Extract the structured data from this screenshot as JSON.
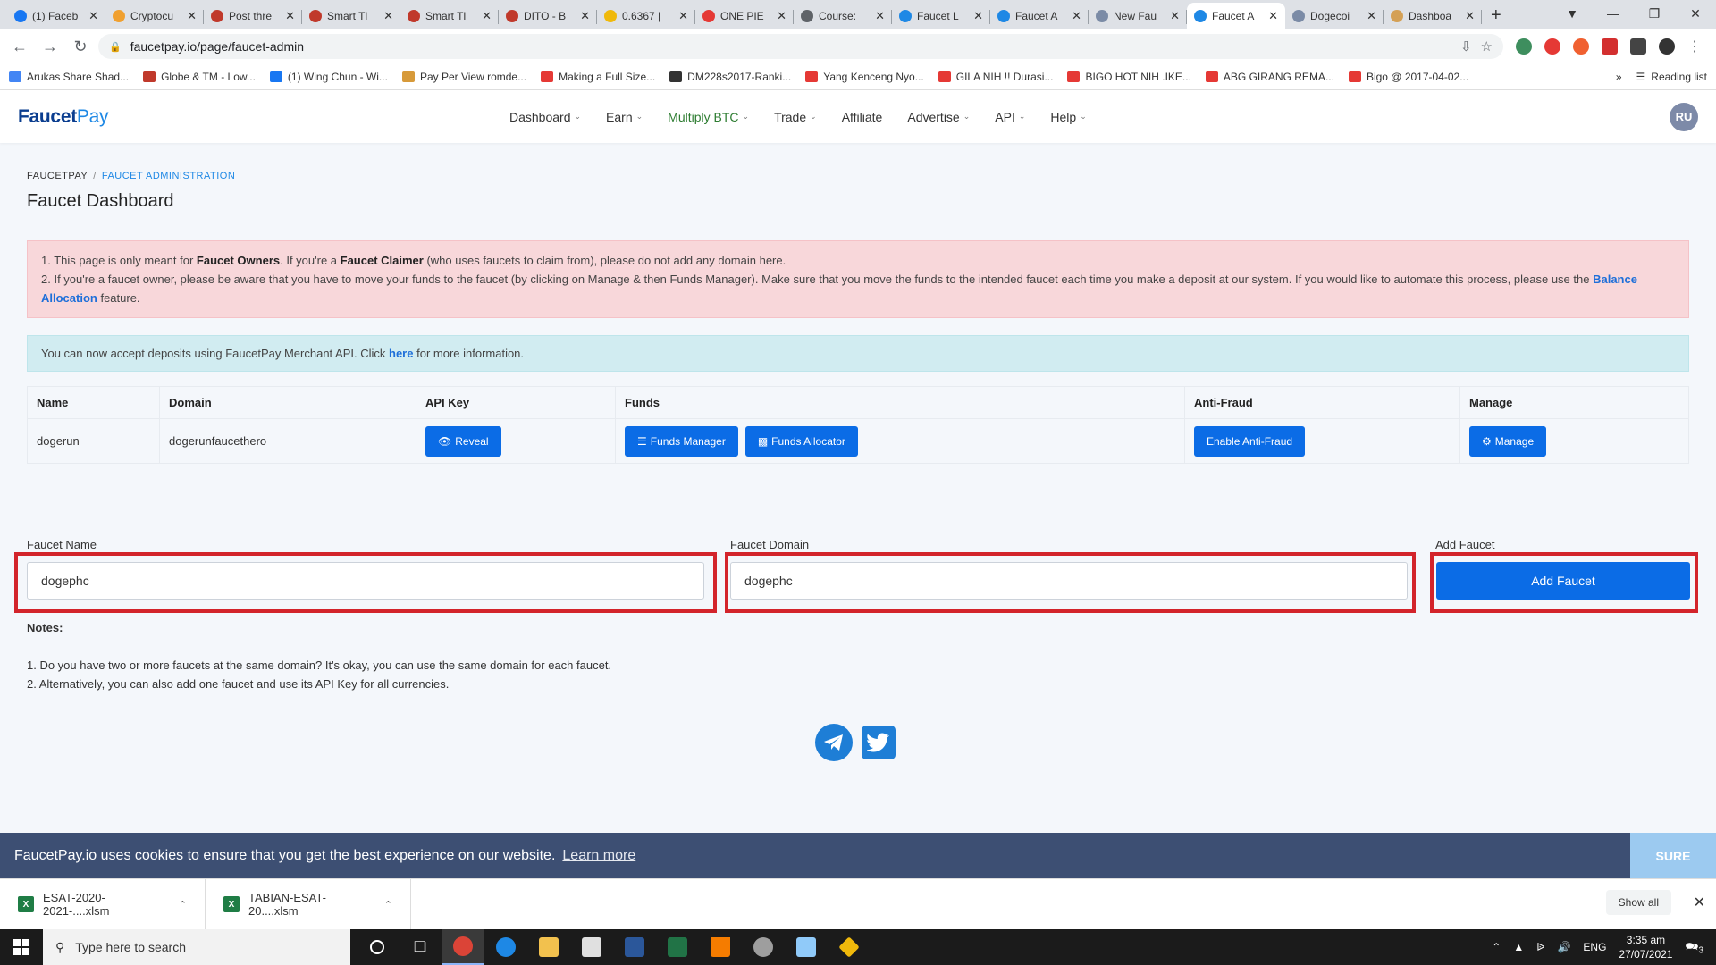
{
  "browser": {
    "tabs": [
      {
        "title": "(1) Faceb",
        "color": "#1877f2"
      },
      {
        "title": "Cryptocu",
        "color": "#f0a030"
      },
      {
        "title": "Post thre",
        "color": "#c0392b"
      },
      {
        "title": "Smart Tl",
        "color": "#c0392b"
      },
      {
        "title": "Smart Tl",
        "color": "#c0392b"
      },
      {
        "title": "DITO - B",
        "color": "#c0392b"
      },
      {
        "title": "0.6367 |",
        "color": "#f0b90b"
      },
      {
        "title": "ONE PIE",
        "color": "#e53935"
      },
      {
        "title": "Course:",
        "color": "#5f6368"
      },
      {
        "title": "Faucet L",
        "color": "#1e88e5"
      },
      {
        "title": "Faucet A",
        "color": "#1e88e5"
      },
      {
        "title": "New Fau",
        "color": "#7b8ba6"
      },
      {
        "title": "Faucet A",
        "color": "#1e88e5"
      },
      {
        "title": "Dogecoi",
        "color": "#7b8ba6"
      },
      {
        "title": "Dashboa",
        "color": "#d4a055"
      }
    ],
    "active_tab_index": 12,
    "url": "faucetpay.io/page/faucet-admin",
    "bookmarks": [
      {
        "label": "Arukas Share Shad...",
        "color": "#4285f4"
      },
      {
        "label": "Globe & TM - Low...",
        "color": "#c0392b"
      },
      {
        "label": "(1) Wing Chun - Wi...",
        "color": "#1877f2"
      },
      {
        "label": "Pay Per View romde...",
        "color": "#d79a3a"
      },
      {
        "label": "Making a Full Size...",
        "color": "#e53935"
      },
      {
        "label": "DM228s2017-Ranki...",
        "color": "#333333"
      },
      {
        "label": "Yang Kenceng Nyo...",
        "color": "#e53935"
      },
      {
        "label": "GILA NIH !! Durasi...",
        "color": "#e53935"
      },
      {
        "label": "BIGO HOT NIH .IKE...",
        "color": "#e53935"
      },
      {
        "label": "ABG GIRANG REMA...",
        "color": "#e53935"
      },
      {
        "label": "Bigo @ 2017-04-02...",
        "color": "#e53935"
      }
    ],
    "reading_list": "Reading list"
  },
  "site": {
    "logo_faucet": "Faucet",
    "logo_pay": "Pay",
    "nav": [
      {
        "label": "Dashboard",
        "caret": true,
        "highlight": false
      },
      {
        "label": "Earn",
        "caret": true,
        "highlight": false
      },
      {
        "label": "Multiply BTC",
        "caret": true,
        "highlight": true
      },
      {
        "label": "Trade",
        "caret": true,
        "highlight": false
      },
      {
        "label": "Affiliate",
        "caret": false,
        "highlight": false
      },
      {
        "label": "Advertise",
        "caret": true,
        "highlight": false
      },
      {
        "label": "API",
        "caret": true,
        "highlight": false
      },
      {
        "label": "Help",
        "caret": true,
        "highlight": false
      }
    ],
    "avatar": "RU"
  },
  "page": {
    "breadcrumb_home": "FAUCETPAY",
    "breadcrumb_sep": "/",
    "breadcrumb_current": "FAUCET ADMINISTRATION",
    "title": "Faucet Dashboard",
    "alert1": {
      "l1_a": "1. This page is only meant for ",
      "l1_b": "Faucet Owners",
      "l1_c": ". If you're a ",
      "l1_d": "Faucet Claimer",
      "l1_e": " (who uses faucets to claim from), please do not add any domain here.",
      "l2_a": "2. If you're a faucet owner, please be aware that you have to move your funds to the faucet (by clicking on Manage & then Funds Manager). Make sure that you move the funds to the intended faucet each time you make a deposit at our system. If you would like to automate this process, please use the ",
      "l2_link": "Balance Allocation",
      "l2_b": " feature."
    },
    "alert2": {
      "a": "You can now accept deposits using FaucetPay Merchant API. Click ",
      "link": "here",
      "b": " for more information."
    },
    "table": {
      "headers": [
        "Name",
        "Domain",
        "API Key",
        "Funds",
        "Anti-Fraud",
        "Manage"
      ],
      "row": {
        "name": "dogerun",
        "domain": "dogerunfaucethero",
        "reveal": "Reveal",
        "funds_manager": "Funds Manager",
        "funds_allocator": "Funds Allocator",
        "anti_fraud": "Enable Anti-Fraud",
        "manage": "Manage"
      }
    },
    "form": {
      "name_label": "Faucet Name",
      "name_value": "dogephc",
      "domain_label": "Faucet Domain",
      "domain_value": "dogephc",
      "add_label": "Add Faucet",
      "add_button": "Add Faucet"
    },
    "notes": {
      "heading": "Notes:",
      "items": [
        "1. Do you have two or more faucets at the same domain? It's okay, you can use the same domain for each faucet.",
        "2. Alternatively, you can also add one faucet and use its API Key for all currencies."
      ]
    }
  },
  "cookie": {
    "text": "FaucetPay.io uses cookies to ensure that you get the best experience on our website.",
    "learn_more": "Learn more",
    "sure": "SURE"
  },
  "downloads": {
    "files": [
      "ESAT-2020-2021-....xlsm",
      "TABIAN-ESAT-20....xlsm"
    ],
    "show_all": "Show all"
  },
  "taskbar": {
    "search_placeholder": "Type here to search",
    "lang": "ENG",
    "time": "3:35 am",
    "date": "27/07/2021",
    "notif_count": "3"
  }
}
